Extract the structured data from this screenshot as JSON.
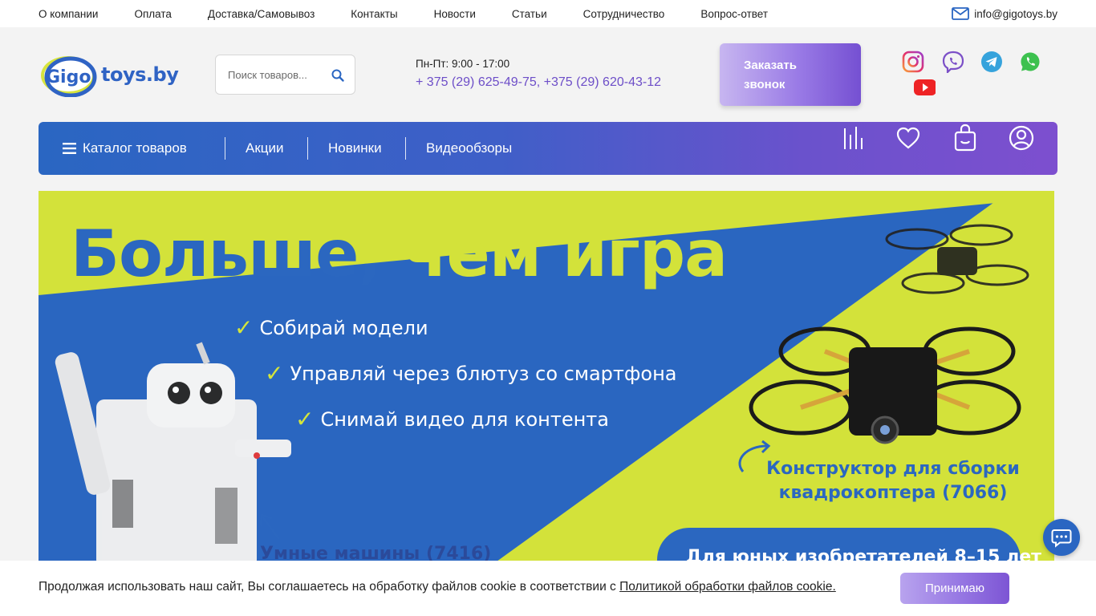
{
  "topnav": {
    "items": [
      "О компании",
      "Оплата",
      "Доставка/Самовывоз",
      "Контакты",
      "Новости",
      "Статьи",
      "Сотрудничество",
      "Вопрос-ответ"
    ],
    "email": "info@gigotoys.by"
  },
  "header": {
    "logo_text": "toys.by",
    "logo_badge": "Gigo",
    "search_placeholder": "Поиск товаров...",
    "hours": "Пн-Пт: 9:00 - 17:00",
    "phones": "+ 375 (29) 625-49-75, +375 (29) 620-43-12",
    "callback_label": "Заказать звонок"
  },
  "socials": [
    "instagram-icon",
    "viber-icon",
    "telegram-icon",
    "whatsapp-icon",
    "youtube-icon"
  ],
  "mainnav": {
    "catalog": "Каталог товаров",
    "items": [
      "Акции",
      "Новинки",
      "Видеообзоры"
    ],
    "icons": [
      "compare-icon",
      "heart-icon",
      "shopping-bag-icon",
      "user-icon"
    ]
  },
  "banner": {
    "title_part1": "Больше, ",
    "title_part2": "чем игра",
    "bullets": [
      "Собирай модели",
      "Управляй через блютуз со смартфона",
      "Снимай видео для контента"
    ],
    "drone_label": "Конструктор для сборки квадрокоптера (7066)",
    "robot_label": "Умные машины (7416)",
    "pill_text": "Для юных изобретателей 8–15 лет"
  },
  "cookie": {
    "text": "Продолжая использовать наш сайт, Вы соглашаетесь на обработку файлов cookie в соответствии с ",
    "link": "Политикой обработки файлов cookie.",
    "accept": "Принимаю"
  },
  "colors": {
    "accent_purple": "#6d4ec8",
    "nav_blue": "#2a66c2",
    "banner_blue": "#2a66c0",
    "banner_lime": "#d3e23a"
  }
}
